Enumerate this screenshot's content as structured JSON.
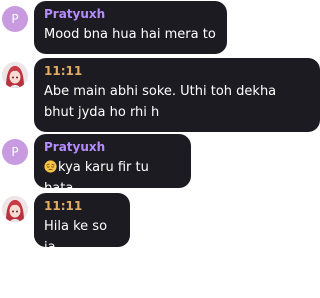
{
  "messages": [
    {
      "sender": "Pratyuxh",
      "avatar": {
        "type": "letter",
        "letter": "P"
      },
      "text": "Mood bna hua hai mera to"
    },
    {
      "sender": "11:11",
      "avatar": {
        "type": "image",
        "description": "anime-girl-red-hair"
      },
      "text": "Abe main abhi soke. Uthi toh dekha bhut jyda ho rhi h"
    },
    {
      "sender": "Pratyuxh",
      "avatar": {
        "type": "letter",
        "letter": "P"
      },
      "emoji": "pensive-face-emoji",
      "text": "kya karu fir tu bata"
    },
    {
      "sender": "11:11",
      "avatar": {
        "type": "image",
        "description": "anime-girl-red-hair"
      },
      "text": "Hila ke so ja"
    }
  ],
  "colors": {
    "bubble_bg": "#1c1b22",
    "name_pratyuxh": "#b58cff",
    "name_1111": "#e1ad62",
    "avatar_letter_bg": "#c89ae0",
    "text": "#ffffff"
  }
}
